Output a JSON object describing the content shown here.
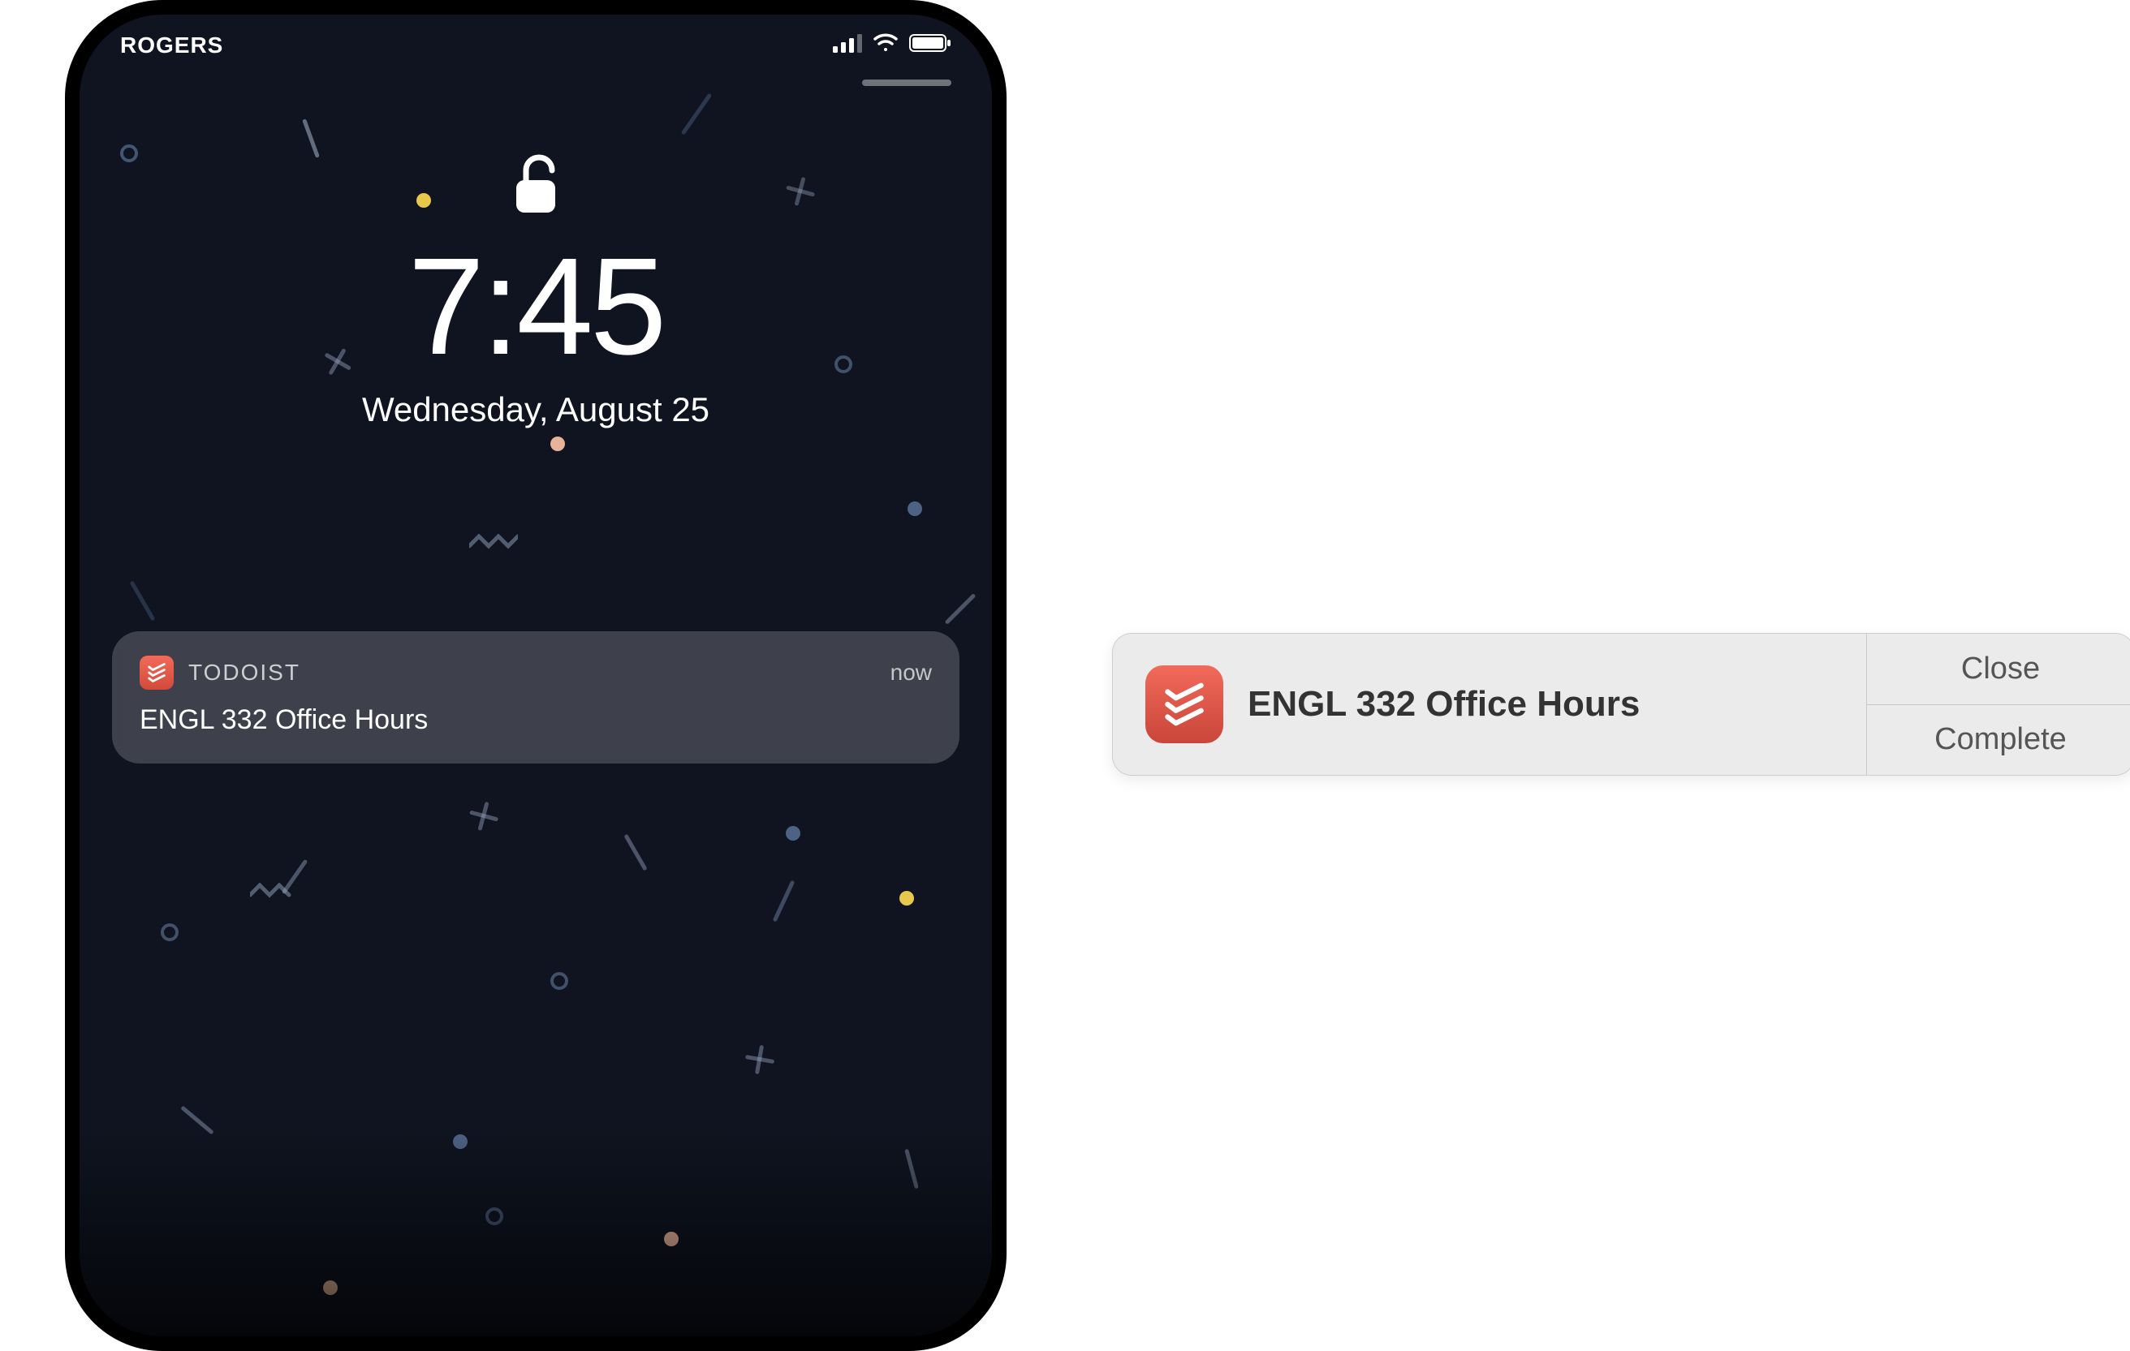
{
  "phone": {
    "status_bar": {
      "carrier": "ROGERS"
    },
    "time": "7:45",
    "date": "Wednesday, August 25",
    "notification": {
      "app_name": "TODOIST",
      "timestamp": "now",
      "title": "ENGL 332 Office Hours"
    }
  },
  "mac_notification": {
    "title": "ENGL 332 Office Hours",
    "button_close": "Close",
    "button_complete": "Complete"
  },
  "colors": {
    "todoist_red_top": "#f26a5a",
    "todoist_red_bottom": "#c9463a",
    "confetti_yellow": "#e7c84d",
    "confetti_peach": "#e7b49a",
    "confetti_blue": "#8aa4d6"
  }
}
